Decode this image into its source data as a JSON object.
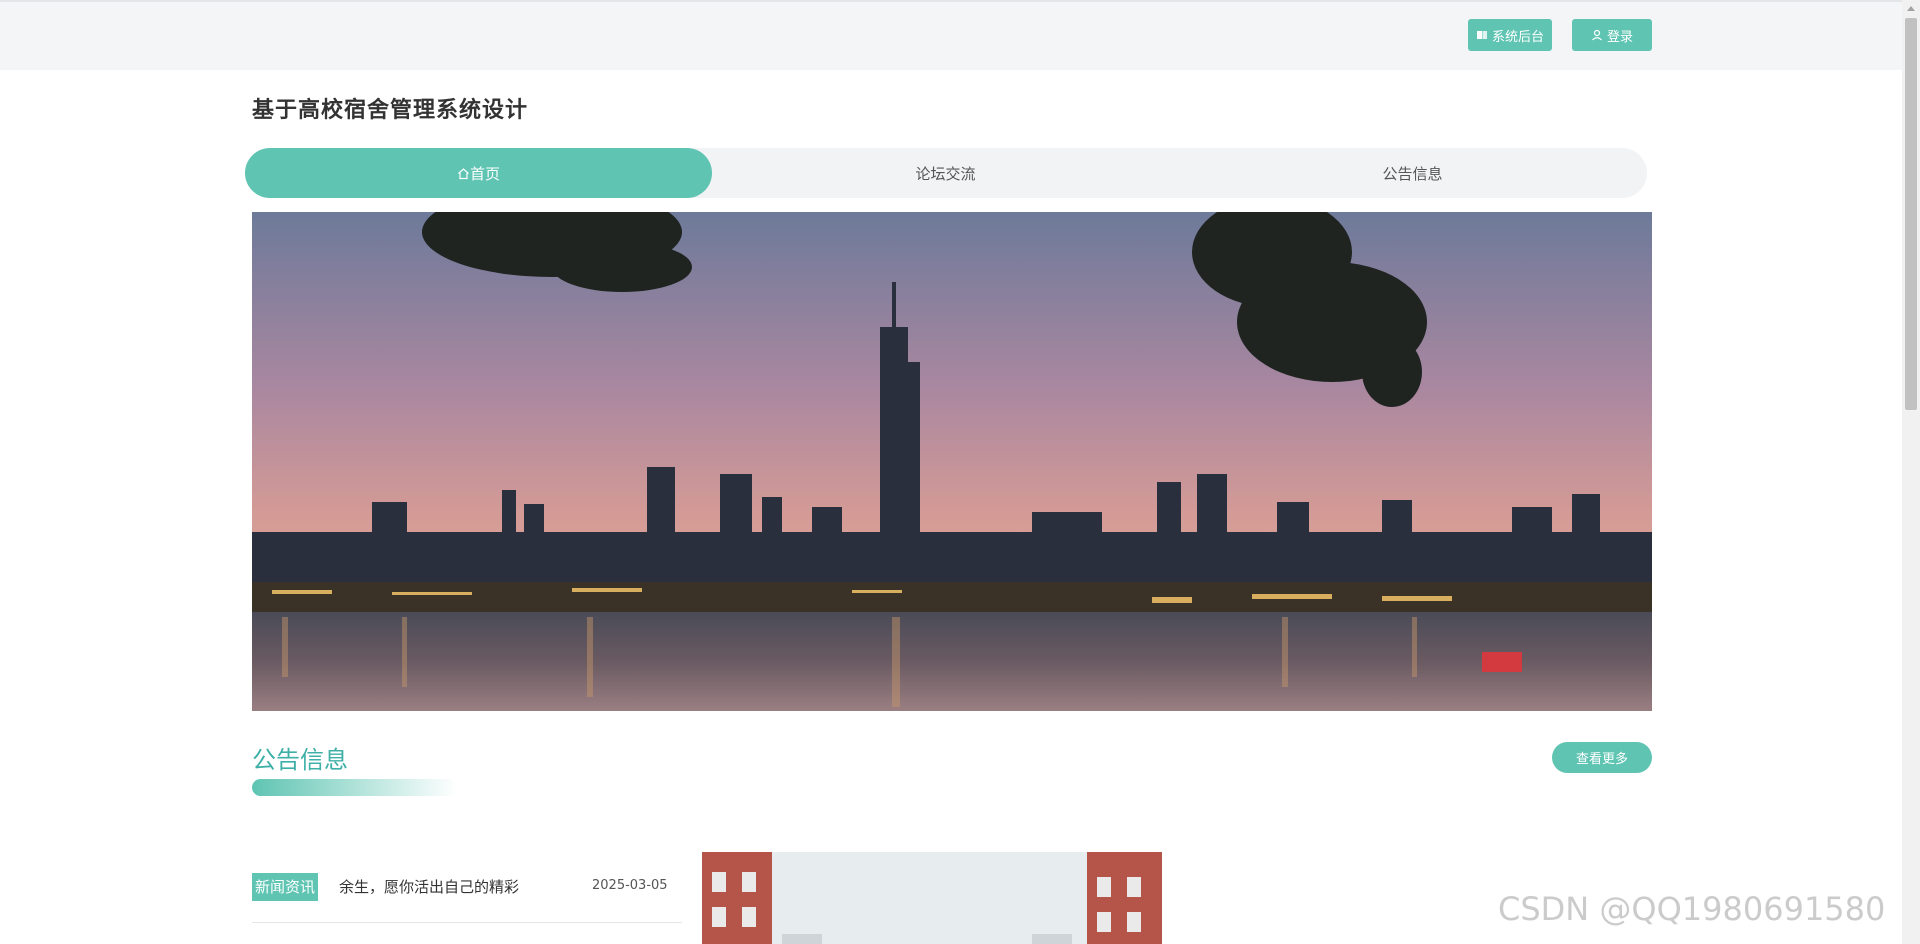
{
  "header": {
    "admin_label": "系统后台",
    "login_label": "登录"
  },
  "site": {
    "title": "基于高校宿舍管理系统设计"
  },
  "nav": {
    "items": [
      {
        "label": "首页",
        "active": true
      },
      {
        "label": "论坛交流",
        "active": false
      },
      {
        "label": "公告信息",
        "active": false
      }
    ]
  },
  "section": {
    "title": "公告信息",
    "more_label": "查看更多"
  },
  "news": {
    "items": [
      {
        "tag": "新闻资讯",
        "title": "余生，愿你活出自己的精彩",
        "date": "2025-03-05"
      }
    ]
  },
  "watermark": "CSDN @QQ1980691580",
  "colors": {
    "accent": "#5fc4b2",
    "title_accent": "#3fb0a8"
  },
  "icons": [
    "book-icon",
    "user-icon",
    "home-icon"
  ]
}
